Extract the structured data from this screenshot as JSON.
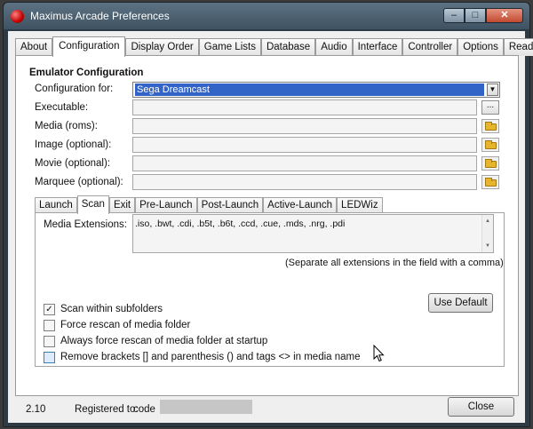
{
  "window": {
    "title": "Maximus Arcade Preferences",
    "minimize_glyph": "–",
    "maximize_glyph": "□",
    "close_glyph": "✕"
  },
  "main_tabs": [
    {
      "label": "About"
    },
    {
      "label": "Configuration",
      "active": true
    },
    {
      "label": "Display Order"
    },
    {
      "label": "Game Lists"
    },
    {
      "label": "Database"
    },
    {
      "label": "Audio"
    },
    {
      "label": "Interface"
    },
    {
      "label": "Controller"
    },
    {
      "label": "Options"
    },
    {
      "label": "Readme"
    }
  ],
  "emulator": {
    "group_title": "Emulator Configuration",
    "config_for_label": "Configuration for:",
    "config_for_value": "Sega Dreamcast",
    "executable_label": "Executable:",
    "executable_value": "",
    "browse_label": "...",
    "media_label": "Media (roms):",
    "media_value": "",
    "image_label": "Image (optional):",
    "image_value": "",
    "movie_label": "Movie (optional):",
    "movie_value": "",
    "marquee_label": "Marquee (optional):",
    "marquee_value": ""
  },
  "sub_tabs": [
    {
      "label": "Launch"
    },
    {
      "label": "Scan",
      "active": true
    },
    {
      "label": "Exit"
    },
    {
      "label": "Pre-Launch"
    },
    {
      "label": "Post-Launch"
    },
    {
      "label": "Active-Launch"
    },
    {
      "label": "LEDWiz"
    }
  ],
  "scan": {
    "media_ext_label": "Media Extensions:",
    "media_ext_value": ".iso, .bwt, .cdi, .b5t, .b6t, .ccd, .cue, .mds, .nrg, .pdi",
    "separate_note": "(Separate all extensions in the field with a comma)",
    "use_default_label": "Use Default",
    "checkboxes": [
      {
        "label": "Scan within subfolders",
        "checked": true
      },
      {
        "label": "Force rescan of media folder",
        "checked": false
      },
      {
        "label": "Always force rescan of media folder at startup",
        "checked": false
      },
      {
        "label": "Remove brackets [] and parenthesis () and tags <> in media name",
        "checked": false
      }
    ]
  },
  "status": {
    "version": "2.10",
    "registered_label": "Registered to:",
    "registered_value": "code",
    "close_label": "Close"
  },
  "colors": {
    "selection": "#3264c8",
    "titlebar": "#4b6070",
    "close_button": "#c04a2f"
  }
}
